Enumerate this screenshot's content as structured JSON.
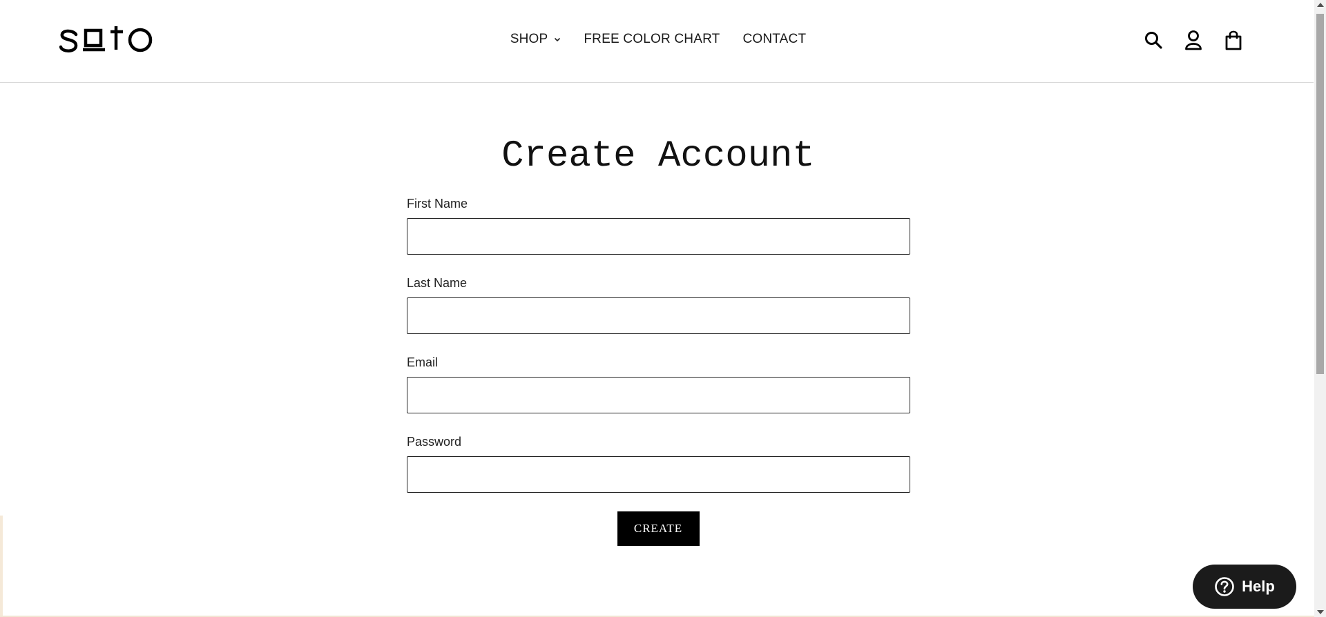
{
  "brand": {
    "logo_text": "soto"
  },
  "nav": {
    "items": [
      {
        "label": "SHOP",
        "has_dropdown": true
      },
      {
        "label": "FREE COLOR CHART",
        "has_dropdown": false
      },
      {
        "label": "CONTACT",
        "has_dropdown": false
      }
    ]
  },
  "header_icons": [
    "search-icon",
    "account-icon",
    "cart-icon"
  ],
  "page": {
    "title": "Create Account"
  },
  "form": {
    "fields": [
      {
        "label": "First Name",
        "value": "",
        "type": "text"
      },
      {
        "label": "Last Name",
        "value": "",
        "type": "text"
      },
      {
        "label": "Email",
        "value": "",
        "type": "email"
      },
      {
        "label": "Password",
        "value": "",
        "type": "password"
      }
    ],
    "submit_label": "CREATE"
  },
  "help": {
    "label": "Help",
    "icon": "question-circle-icon"
  },
  "colors": {
    "primary": "#000000",
    "accent_strip": "#f5e9d8",
    "help_bg": "#1b1b1b"
  }
}
